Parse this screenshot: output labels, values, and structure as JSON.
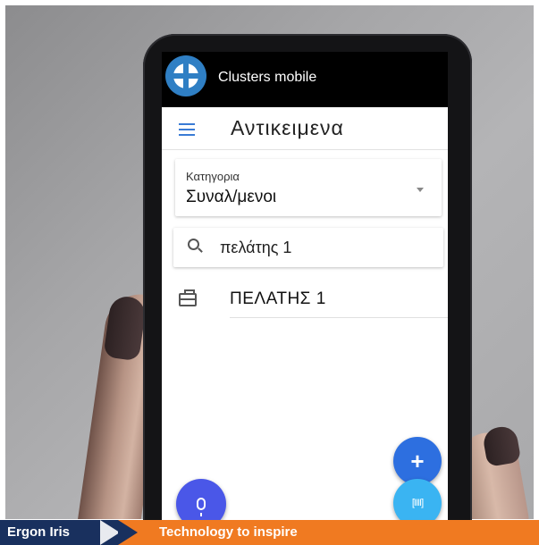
{
  "app": {
    "title": "Clusters mobile"
  },
  "header": {
    "title": "Αντικειμενα"
  },
  "category": {
    "label": "Κατηγορια",
    "value": "Συναλ/μενοι"
  },
  "search": {
    "value": "πελάτης 1"
  },
  "results": [
    {
      "label": "ΠΕΛΑΤΗΣ 1",
      "icon": "briefcase-icon"
    }
  ],
  "fabs": {
    "add_label": "+",
    "scan_label": "[IIII]"
  },
  "banner": {
    "brand": "Ergon Iris",
    "tagline": "Technology to inspire"
  },
  "colors": {
    "brand_blue": "#19305e",
    "accent_orange": "#f07a21",
    "fab_add": "#2d6fe0",
    "fab_scan": "#3ab4f2",
    "fab_mic": "#4a57e8"
  }
}
